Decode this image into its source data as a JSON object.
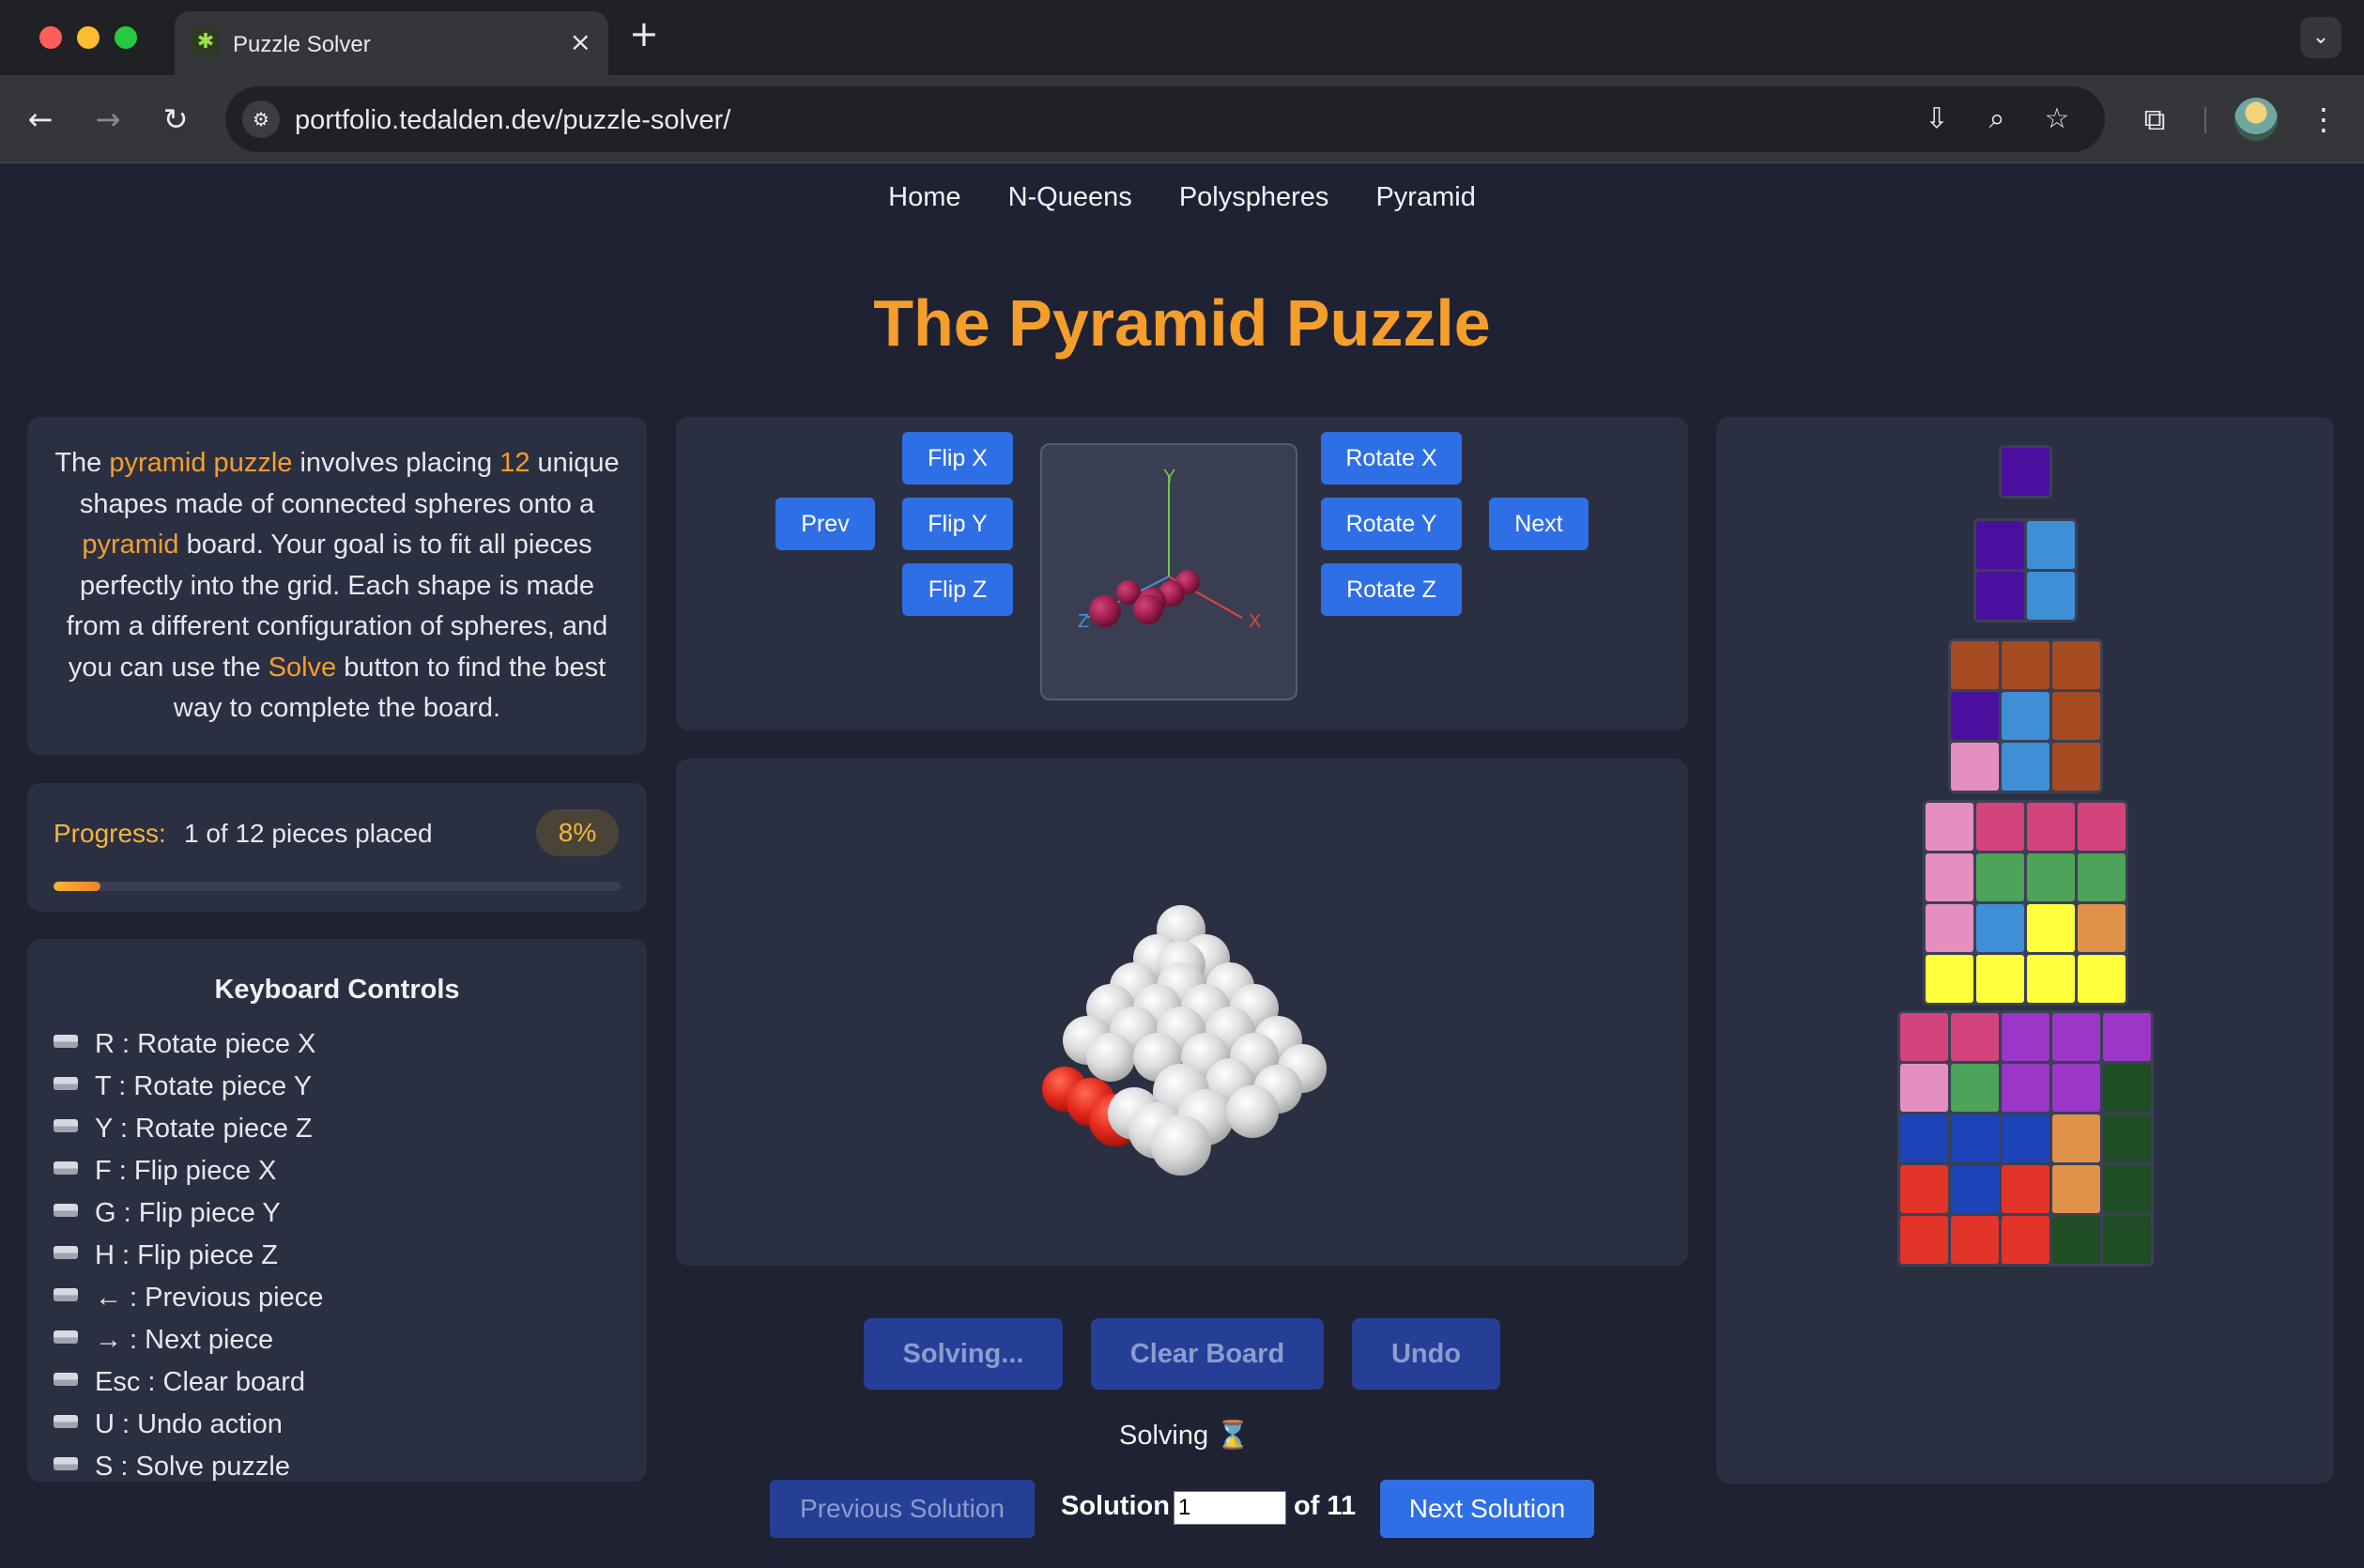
{
  "browser": {
    "tab_title": "Puzzle Solver",
    "tab_close": "×",
    "new_tab": "+",
    "tab_menu": "⌄",
    "favicon": "✱",
    "url": "portfolio.tedalden.dev/puzzle-solver/",
    "icons": [
      "back-arrow-icon",
      "forward-arrow-icon",
      "reload-icon",
      "site-info-icon",
      "install-app-icon",
      "zoom-icon",
      "bookmark-star-icon",
      "extensions-icon",
      "profile-avatar",
      "more-menu-icon"
    ]
  },
  "nav": {
    "items": [
      "Home",
      "N-Queens",
      "Polyspheres",
      "Pyramid"
    ]
  },
  "page_title": "The Pyramid Puzzle",
  "intro": {
    "p1": "The ",
    "h1": "pyramid puzzle",
    "p2": " involves placing ",
    "h2": "12",
    "p3": " unique shapes made of connected spheres onto a ",
    "h3": "pyramid",
    "p4": " board. Your goal is to fit all pieces perfectly into the grid. Each shape is made from a different configuration of spheres, and you can use the ",
    "h4": "Solve",
    "p5": " button to find the best way to complete the board."
  },
  "progress": {
    "label": "Progress:",
    "text": "1 of 12 pieces placed",
    "percent_label": "8%",
    "fraction": 0.083
  },
  "keyboard": {
    "title": "Keyboard Controls",
    "items": [
      "R : Rotate piece X",
      "T : Rotate piece Y",
      "Y : Rotate piece Z",
      "F : Flip piece X",
      "G : Flip piece Y",
      "H : Flip piece Z",
      "← : Previous piece",
      "→ : Next piece",
      "Esc : Clear board",
      "U : Undo action",
      "S : Solve puzzle"
    ]
  },
  "piece_controls": {
    "prev": "Prev",
    "next": "Next",
    "flip_x": "Flip X",
    "flip_y": "Flip Y",
    "flip_z": "Flip Z",
    "rotate_x": "Rotate X",
    "rotate_y": "Rotate Y",
    "rotate_z": "Rotate Z",
    "axis_x": "X",
    "axis_y": "Y",
    "axis_z": "Z"
  },
  "actions": {
    "solving": "Solving...",
    "clear": "Clear Board",
    "undo": "Undo"
  },
  "status": "Solving ⌛",
  "solutions": {
    "previous": "Previous Solution",
    "label": "Solution",
    "current": "1",
    "of_total": "of 11",
    "next": "Next Solution"
  },
  "colors": {
    "accent": "#f59e2b",
    "button": "#2f6fe6",
    "button_disabled": "#263f96"
  },
  "layers": [
    [
      [
        "#4b0fa0"
      ]
    ],
    [
      [
        "#4b0fa0",
        "#3e8fd6"
      ],
      [
        "#4b0fa0",
        "#3e8fd6"
      ]
    ],
    [
      [
        "#a64b22",
        "#a64b22",
        "#a64b22"
      ],
      [
        "#4b0fa0",
        "#3e8fd6",
        "#a64b22"
      ],
      [
        "#e48fc0",
        "#3e8fd6",
        "#a64b22"
      ]
    ],
    [
      [
        "#e48fc0",
        "#d4447c",
        "#d4447c",
        "#d4447c"
      ],
      [
        "#e48fc0",
        "#4ea35a",
        "#4ea35a",
        "#4ea35a"
      ],
      [
        "#e48fc0",
        "#3e8fd6",
        "#ffff3b",
        "#e0924a"
      ],
      [
        "#ffff3b",
        "#ffff3b",
        "#ffff3b",
        "#ffff3b"
      ]
    ],
    [
      [
        "#d4447c",
        "#d4447c",
        "#9b36c8",
        "#9b36c8",
        "#9b36c8"
      ],
      [
        "#e48fc0",
        "#4ea35a",
        "#9b36c8",
        "#9b36c8",
        "#1f4d26"
      ],
      [
        "#1c44b8",
        "#1c44b8",
        "#1c44b8",
        "#e0924a",
        "#1f4d26"
      ],
      [
        "#e3342a",
        "#1c44b8",
        "#e3342a",
        "#e0924a",
        "#1f4d26"
      ],
      [
        "#e3342a",
        "#e3342a",
        "#e3342a",
        "#1f4d26",
        "#1f4d26"
      ]
    ]
  ]
}
